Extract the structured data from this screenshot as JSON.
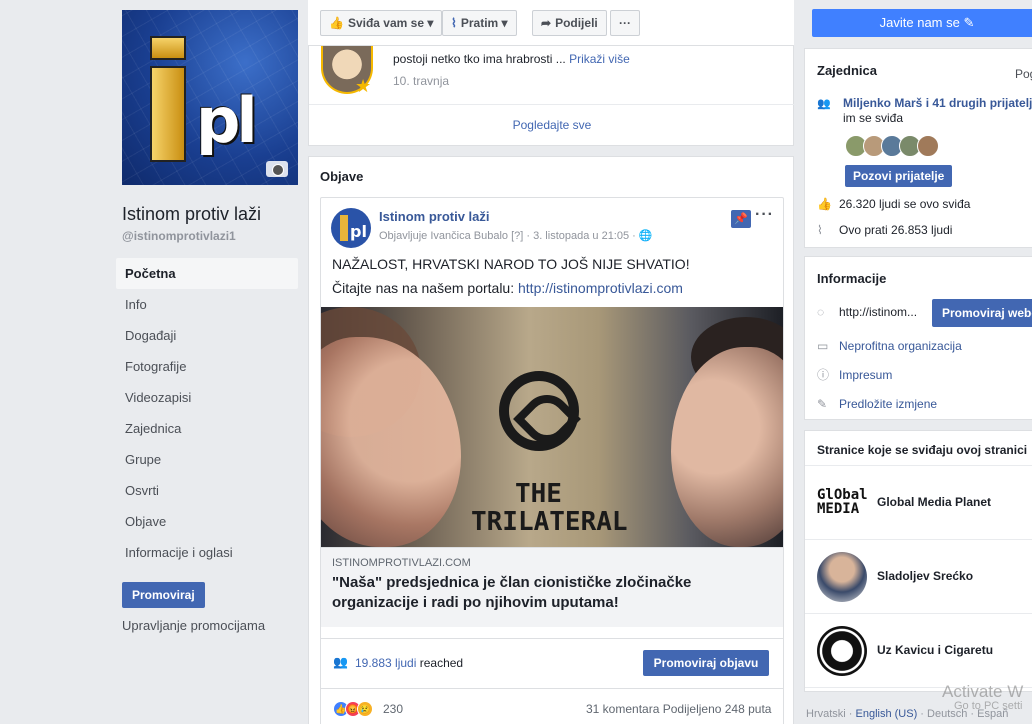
{
  "page": {
    "name": "Istinom protiv laži",
    "handle": "@istinomprotivlazi1"
  },
  "left_nav": {
    "items": [
      "Početna",
      "Info",
      "Događaji",
      "Fotografije",
      "Videozapisi",
      "Zajednica",
      "Grupe",
      "Osvrti",
      "Objave",
      "Informacije i oglasi"
    ],
    "active_index": 0,
    "promote_label": "Promoviraj",
    "manage_promotions_label": "Upravljanje promocijama"
  },
  "action_bar": {
    "like_label": "Sviđa vam se",
    "follow_label": "Pratim",
    "share_label": "Podijeli",
    "more_label": "···"
  },
  "review_card": {
    "text": "postoji netko tko ima hrabrosti ... ",
    "more_label": "Prikaži više",
    "date": "10. travnja",
    "see_all_label": "Pogledajte sve"
  },
  "posts": {
    "section_title": "Objave",
    "post": {
      "author": "Istinom protiv laži",
      "meta": "Objavljuje Ivančica Bubalo [?] · 3. listopada u 21:05 ·",
      "text1": "NAŽALOST, HRVATSKI NAROD TO JOŠ NIJE SHVATIO!",
      "text2_prefix": "Čitajte nas na našem portalu: ",
      "text2_link": "http://istinomprotivlazi.com",
      "image_text_line1": "THE",
      "image_text_line2": "TRILATERAL",
      "link_domain": "ISTINOMPROTIVLAZI.COM",
      "link_title": "\"Naša\" predsjednica je član cionističke zločinačke organizacije i radi po njihovim uputama!",
      "reach_number": "19.883 ljudi",
      "reach_suffix": " reached",
      "boost_label": "Promoviraj objavu",
      "reaction_count": "230",
      "comments_shares": "31 komentara  Podijeljeno 248 puta"
    }
  },
  "right": {
    "contact_label": "Javite nam se ✎",
    "community": {
      "title": "Zajednica",
      "see_label": "Pog",
      "friends_bold": "Miljenko Marš i 41 drugih prijatelja",
      "friends_suffix": " im se sviđa",
      "invite_label": "Pozovi prijatelje",
      "likes_text": "26.320 ljudi se ovo sviđa",
      "follows_text": "Ovo prati 26.853 ljudi"
    },
    "info": {
      "title": "Informacije",
      "website": "http://istinom...",
      "promote_web_label": "Promoviraj web-",
      "category": "Neprofitna organizacija",
      "impressum": "Impresum",
      "suggest_edit": "Predložite izmjene"
    },
    "liked_pages": {
      "title": "Stranice koje se sviđaju ovoj stranici",
      "items": [
        "Global Media Planet",
        "Sladoljev Srećko",
        "Uz Kavicu i Cigaretu"
      ],
      "global_logo_text": "GlObal MEDIA"
    },
    "footer_langs": {
      "prefix": "Hrvatski · ",
      "selected": "English (US)",
      "rest": " · Deutsch · Españ"
    }
  },
  "watermark": {
    "line1": "Activate W",
    "line2": "Go to PC setti"
  },
  "colors": {
    "fb_blue": "#4267b2",
    "link_blue": "#385898",
    "contact_blue": "#4080ff",
    "background": "#e9ebee"
  }
}
